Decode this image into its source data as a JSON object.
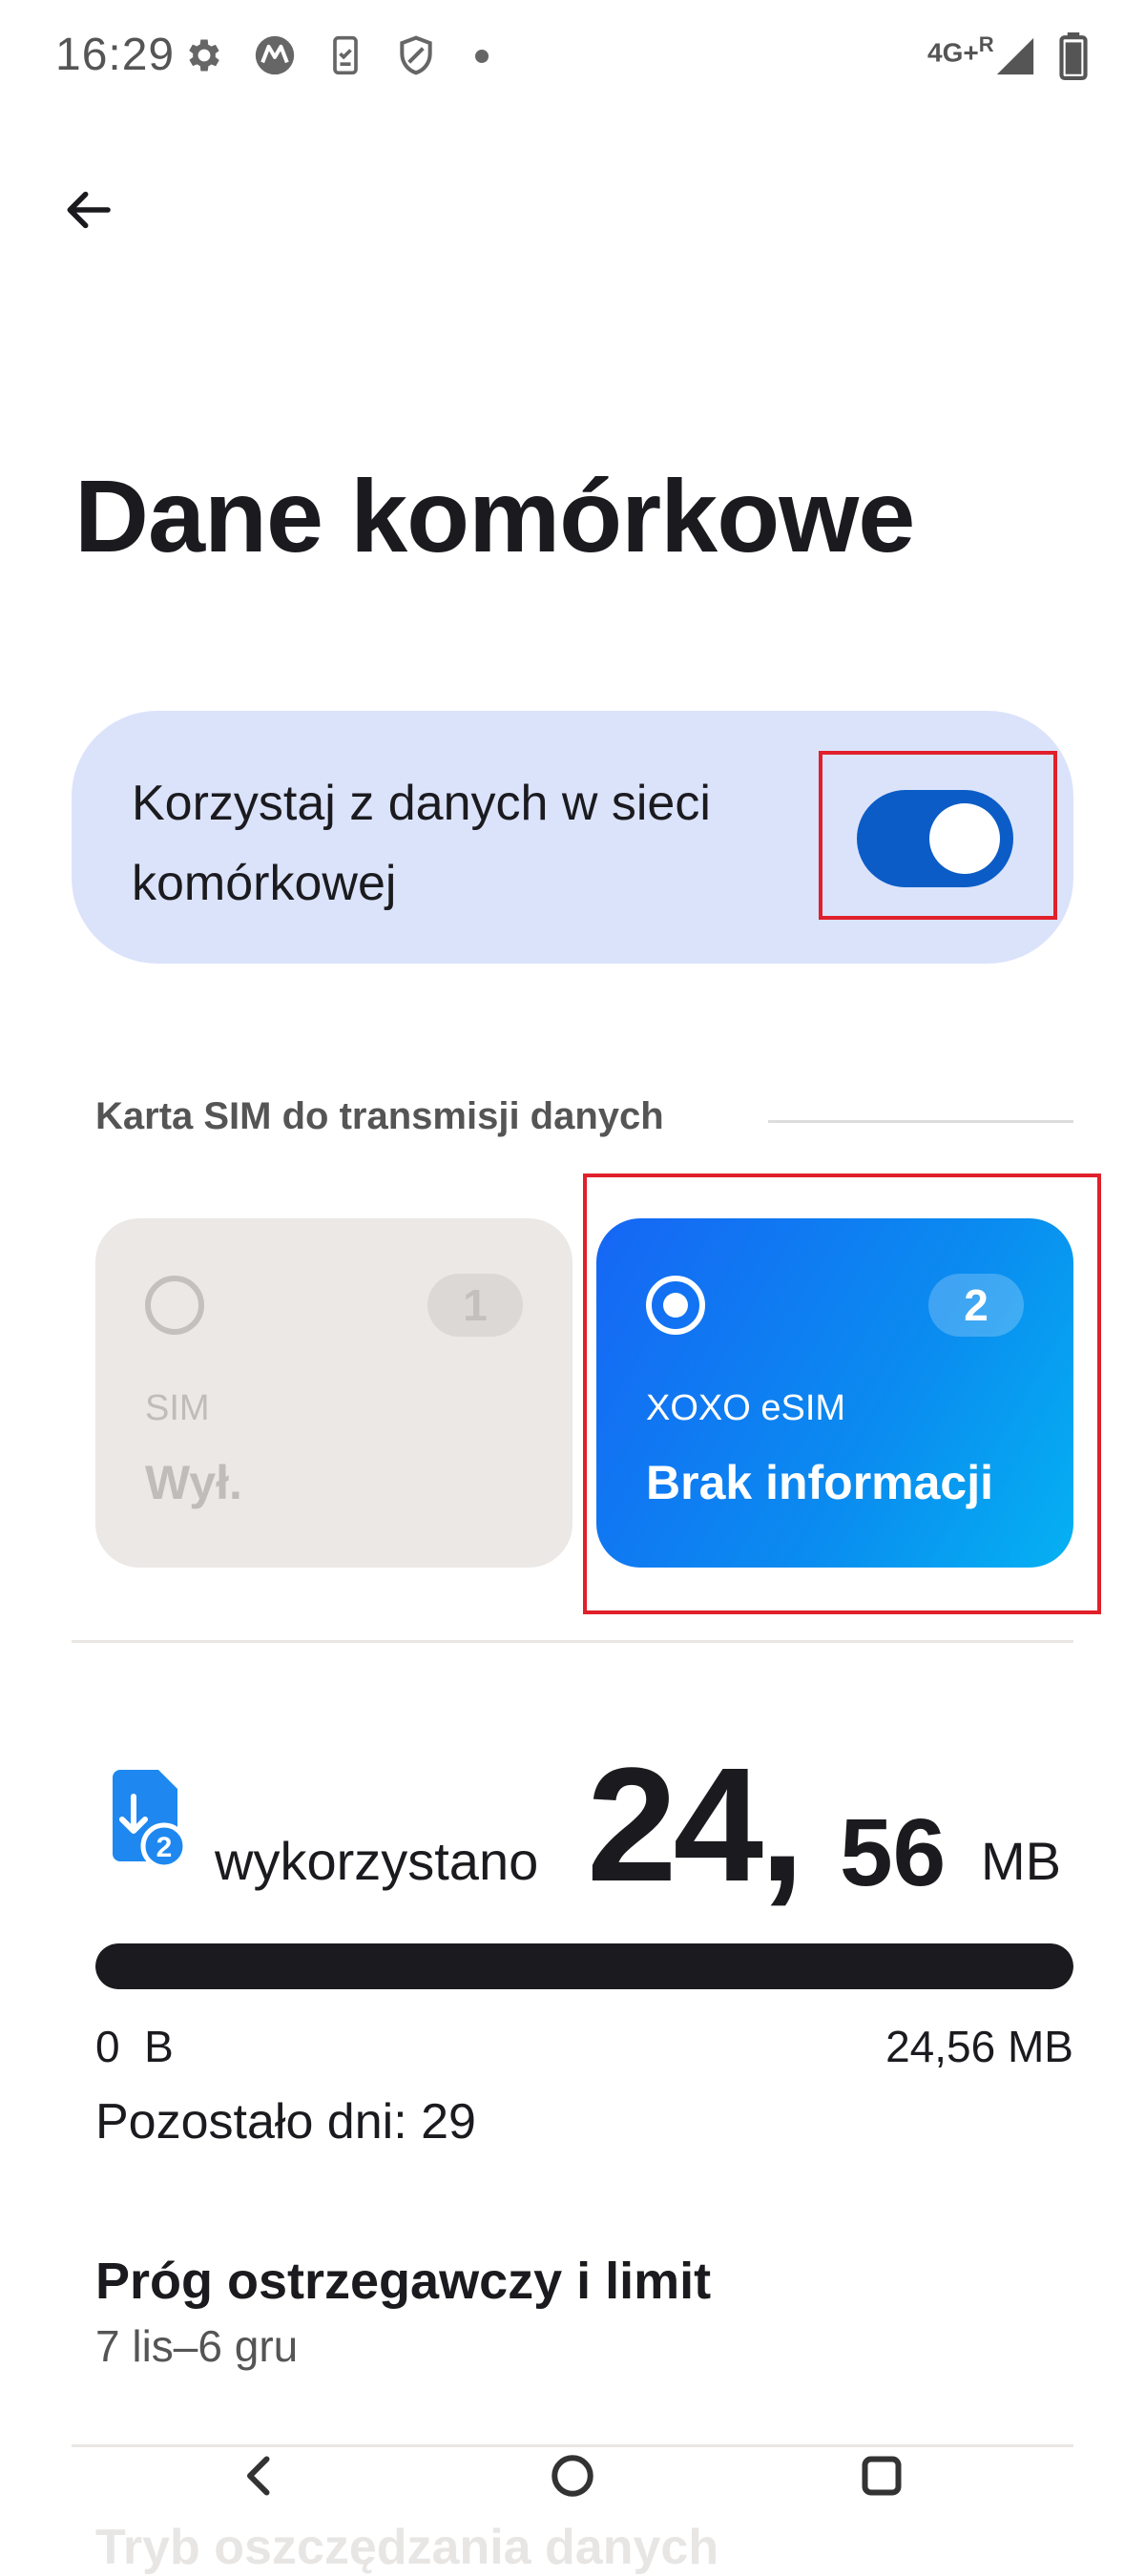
{
  "status_bar": {
    "time": "16:29",
    "icons": [
      "settings-icon",
      "motorola-icon",
      "phone-clipboard-icon",
      "shield-icon",
      "dot-icon"
    ],
    "network": "4G+",
    "roaming": "R",
    "signal_icon": "signal-icon",
    "battery_icon": "battery-icon"
  },
  "header": {
    "back_icon": "arrow-left-icon",
    "title": "Dane komórkowe"
  },
  "mobile_data": {
    "label": "Korzystaj z danych w sieci komórkowej",
    "enabled": true,
    "accent_color": "#0b5cc6"
  },
  "sim_section": {
    "header": "Karta SIM do transmisji danych",
    "cards": [
      {
        "number": "1",
        "name": "SIM",
        "status": "Wył.",
        "selected": false
      },
      {
        "number": "2",
        "name": "XOXO eSIM",
        "status": "Brak informacji",
        "selected": true
      }
    ]
  },
  "usage": {
    "label": "wykorzystano",
    "value_int": "24,",
    "value_dec": "56",
    "unit": "MB",
    "progress_fraction": 1.0,
    "range_min": "0  B",
    "range_max": "24,56 MB",
    "days_left": "Pozostało dni: 29",
    "sim_icon_badge": "2"
  },
  "limit": {
    "title": "Próg ostrzegawczy i limit",
    "subtitle": "7 lis–6 gru"
  },
  "partial_row": {
    "label": "Tryb oszczędzania danych"
  },
  "nav_bar": {
    "items": [
      "back-nav-icon",
      "home-nav-icon",
      "recents-nav-icon"
    ]
  },
  "highlight_color": "#e0202a"
}
